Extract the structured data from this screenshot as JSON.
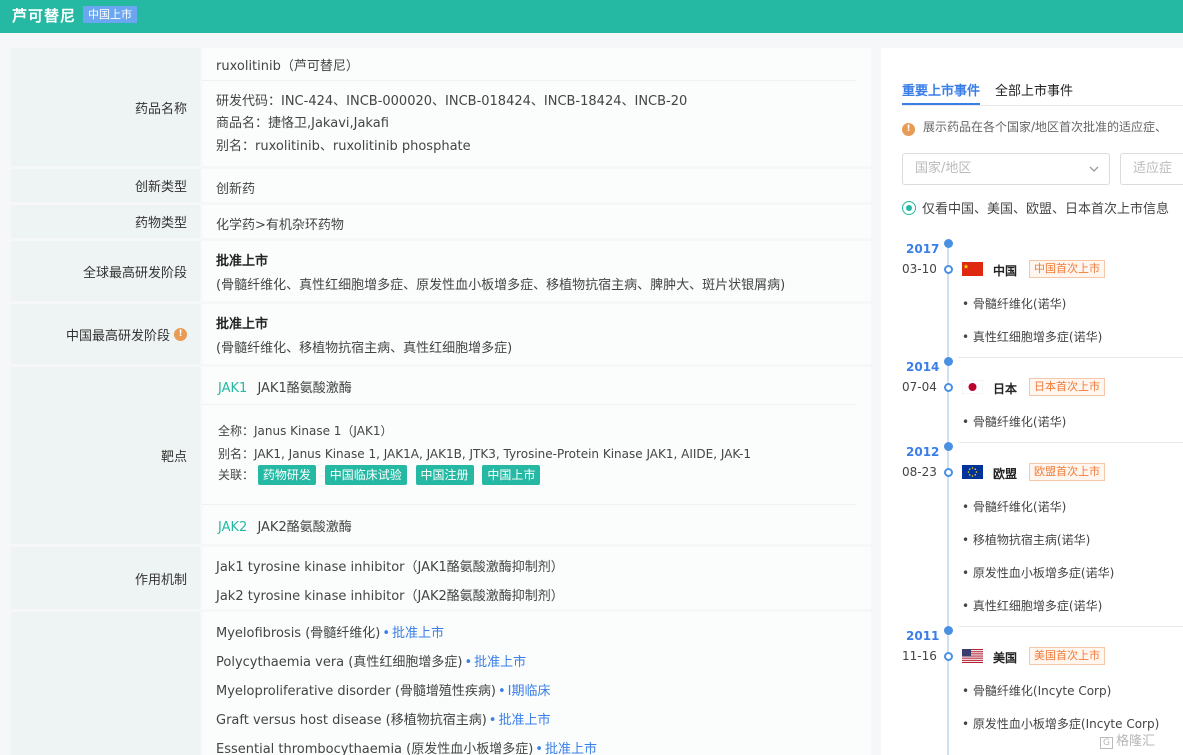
{
  "header": {
    "title": "芦可替尼",
    "badge": "中国上市"
  },
  "drug": {
    "name_label": "药品名称",
    "name": "ruxolitinib（芦可替尼）",
    "codes": "研发代码：INC-424、INCB-000020、INCB-018424、INCB-18424、INCB-20",
    "trade": "商品名：捷恪卫,Jakavi,Jakafi",
    "alias": "别名：ruxolitinib、ruxolitinib phosphate",
    "innov_label": "创新类型",
    "innov": "创新药",
    "type_label": "药物类型",
    "type": "化学药>有机杂环药物",
    "global_label": "全球最高研发阶段",
    "global_stage": "批准上市",
    "global_ind": "(骨髓纤维化、真性红细胞增多症、原发性血小板增多症、移植物抗宿主病、脾肿大、斑片状银屑病)",
    "china_label": "中国最高研发阶段",
    "china_stage": "批准上市",
    "china_ind": "(骨髓纤维化、移植物抗宿主病、真性红细胞增多症)",
    "target_label": "靶点",
    "jak1_code": "JAK1",
    "jak1_name": "JAK1酪氨酸激酶",
    "jak1_full": "全称：Janus Kinase 1（JAK1）",
    "jak1_alias": "别名：JAK1, Janus Kinase 1, JAK1A, JAK1B, JTK3, Tyrosine-Protein Kinase JAK1, AIIDE, JAK-1",
    "assoc_label": "关联：",
    "tags": [
      "药物研发",
      "中国临床试验",
      "中国注册",
      "中国上市"
    ],
    "jak2_code": "JAK2",
    "jak2_name": "JAK2酪氨酸激酶",
    "mech_label": "作用机制",
    "mech1": "Jak1 tyrosine kinase inhibitor（JAK1酪氨酸激酶抑制剂）",
    "mech2": "Jak2 tyrosine kinase inhibitor（JAK2酪氨酸激酶抑制剂）",
    "indications": [
      {
        "name": "Myelofibrosis (骨髓纤维化)",
        "stage": "批准上市"
      },
      {
        "name": "Polycythaemia vera (真性红细胞增多症)",
        "stage": "批准上市"
      },
      {
        "name": "Myeloproliferative disorder (骨髓增殖性疾病)",
        "stage": "Ⅰ期临床"
      },
      {
        "name": "Graft versus host disease (移植物抗宿主病)",
        "stage": "批准上市"
      },
      {
        "name": "Essential thrombocythaemia (原发性血小板增多症)",
        "stage": "批准上市"
      }
    ]
  },
  "panel": {
    "tab_important": "重要上市事件",
    "tab_all": "全部上市事件",
    "desc": "展示药品在各个国家/地区首次批准的适应症、",
    "country_placeholder": "国家/地区",
    "indication_placeholder": "适应症",
    "radio_label": "仅看中国、美国、欧盟、日本首次上市信息"
  },
  "timeline": [
    {
      "year": "2017",
      "date": "03-10",
      "country": "中国",
      "badge": "中国首次上市",
      "items": [
        "骨髓纤维化(诺华)",
        "真性红细胞增多症(诺华)"
      ]
    },
    {
      "year": "2014",
      "date": "07-04",
      "country": "日本",
      "badge": "日本首次上市",
      "items": [
        "骨髓纤维化(诺华)"
      ]
    },
    {
      "year": "2012",
      "date": "08-23",
      "country": "欧盟",
      "badge": "欧盟首次上市",
      "items": [
        "骨髓纤维化(诺华)",
        "移植物抗宿主病(诺华)",
        "原发性血小板增多症(诺华)",
        "真性红细胞增多症(诺华)"
      ]
    },
    {
      "year": "2011",
      "date": "11-16",
      "country": "美国",
      "badge": "美国首次上市",
      "items": [
        "骨髓纤维化(Incyte Corp)",
        "原发性血小板增多症(Incyte Corp)"
      ]
    }
  ],
  "watermark": "格隆汇",
  "colors": {
    "header": "#25b9a3",
    "accent_blue": "#3a7ee8",
    "badge_orange": "#f07b3a"
  }
}
